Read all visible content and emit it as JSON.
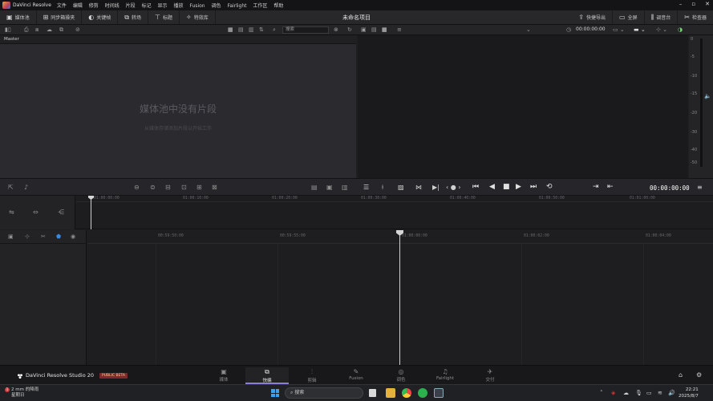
{
  "app": {
    "name": "DaVinci Resolve",
    "menu": [
      "文件",
      "编辑",
      "修剪",
      "时间线",
      "片段",
      "标记",
      "显示",
      "播放",
      "Fusion",
      "调色",
      "Fairlight",
      "工作区",
      "帮助"
    ],
    "project_title": "未命名项目"
  },
  "toolbar": {
    "left": [
      {
        "label": "媒体池",
        "icon": "media-pool-icon"
      },
      {
        "label": "同步箱操夹",
        "icon": "sync-bin-icon"
      },
      {
        "label": "关键帧",
        "icon": "keyframe-icon"
      },
      {
        "label": "转场",
        "icon": "transitions-icon"
      },
      {
        "label": "标题",
        "icon": "titles-icon"
      },
      {
        "label": "特效库",
        "icon": "effects-icon"
      }
    ],
    "right": [
      {
        "label": "快捷导出",
        "icon": "quick-export-icon"
      },
      {
        "label": "全屏",
        "icon": "fullscreen-icon"
      },
      {
        "label": "调音台",
        "icon": "mixer-icon"
      },
      {
        "label": "检查器",
        "icon": "inspector-icon"
      }
    ]
  },
  "subbar": {
    "search_placeholder": "搜索",
    "viewer_timecode": "00:00:00:00"
  },
  "media_pool": {
    "bin_name": "Master",
    "empty_title": "媒体池中没有片段",
    "empty_hint": "从媒体存储添加片段以开始工作"
  },
  "meters": {
    "scale": [
      "0",
      "-5",
      "-10",
      "-15",
      "-20",
      "-30",
      "-40",
      "-50"
    ]
  },
  "transport": {
    "timecode": "00:00:00:00"
  },
  "upper_ruler": [
    "01:00:00:00",
    "01:00:10:00",
    "01:00:20:00",
    "01:00:30:00",
    "01:00:40:00",
    "01:00:50:00",
    "01:01:00:00"
  ],
  "lower_ruler": [
    "00:59:50:00",
    "00:59:55:00",
    "01:00:00:00",
    "01:00:02:00",
    "01:00:04:00"
  ],
  "footer": {
    "brand": "DaVinci Resolve Studio 20",
    "beta": "PUBLIC BETA",
    "pages": [
      {
        "label": "媒体",
        "icon": "media-page-icon",
        "active": false
      },
      {
        "label": "快编",
        "icon": "cut-page-icon",
        "active": true
      },
      {
        "label": "剪辑",
        "icon": "edit-page-icon",
        "active": false
      },
      {
        "label": "Fusion",
        "icon": "fusion-page-icon",
        "active": false
      },
      {
        "label": "调色",
        "icon": "color-page-icon",
        "active": false
      },
      {
        "label": "Fairlight",
        "icon": "fairlight-page-icon",
        "active": false
      },
      {
        "label": "交付",
        "icon": "deliver-page-icon",
        "active": false
      }
    ]
  },
  "taskbar": {
    "weather_badge": "1",
    "weather_line1": "2 mm 的降雨",
    "weather_line2": "星期日",
    "search_label": "搜索",
    "time": "22:21",
    "date": "2025/8/7"
  },
  "colors": {
    "accent": "#8a7de0",
    "panel": "#2b2b2f",
    "viewer": "#1a1a1c",
    "beta_badge": "#7d2a2a"
  }
}
